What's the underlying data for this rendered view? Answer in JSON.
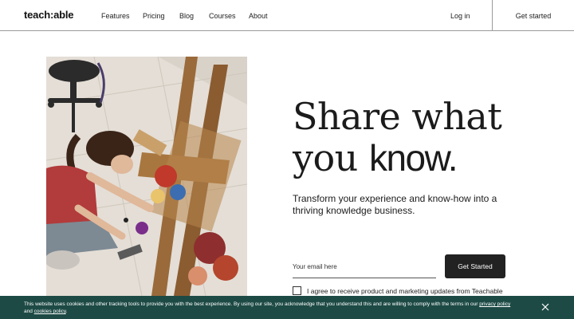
{
  "header": {
    "logo": "teach:able",
    "nav": [
      "Features",
      "Pricing",
      "Blog",
      "Courses",
      "About"
    ],
    "login": "Log in",
    "get_started": "Get started"
  },
  "hero": {
    "headline_line1": "Share what",
    "headline_line2_a": "you ",
    "headline_line2_b": "know.",
    "subtext": "Transform your experience and know-how into a thriving knowledge business.",
    "email_placeholder": "Your email here",
    "cta": "Get Started",
    "consent": "I agree to receive product and marketing updates from Teachable"
  },
  "cookie_banner": {
    "text": "This website uses cookies and other tracking tools to provide you with the best experience. By using our site, you acknowledge that you understand this and are willing to comply with the terms in our",
    "privacy_link": "privacy policy",
    "and": "and",
    "cookies_link": "cookies policy",
    "period": "."
  },
  "colors": {
    "banner_bg": "#1d4a45",
    "button_bg": "#222222",
    "text": "#1b1b1b"
  }
}
